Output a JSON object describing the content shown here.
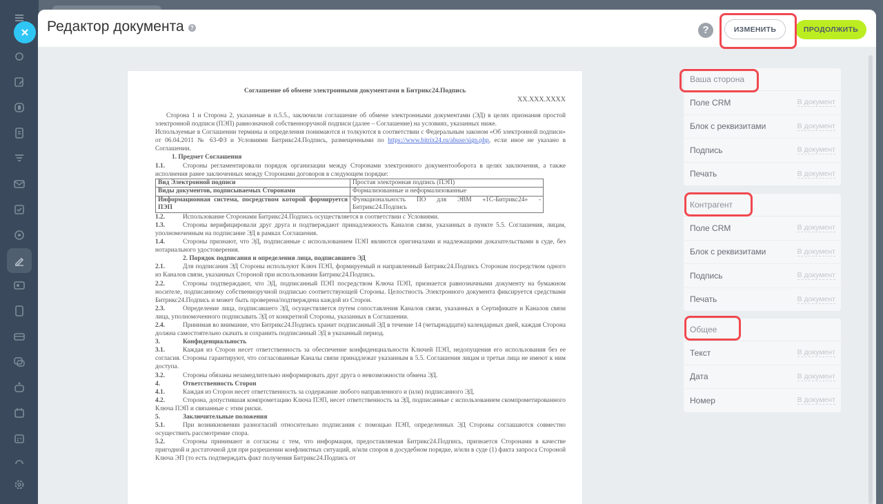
{
  "slider": {
    "title": "Редактор документа",
    "help_mark": "?",
    "help_button": "?",
    "change_label": "ИЗМЕНИТЬ",
    "continue_label": "ПРОДОЛЖИТЬ"
  },
  "app_sidebar": {
    "icons": [
      "menu-icon",
      "close-icon",
      "activity-icon",
      "tasks-edit-icon",
      "crm-icon",
      "document-icon",
      "filter-icon",
      "mail-icon",
      "checklist-icon",
      "target-icon",
      "sign-icon",
      "contact-card-icon",
      "file-icon",
      "storage-icon",
      "chat-icon",
      "bot-icon",
      "calendar-icon",
      "schedule-icon",
      "cloud-icon",
      "settings-icon"
    ]
  },
  "document": {
    "title": "Соглашение об обмене электронными документами в Битрикс24.Подпись",
    "number": "XX.XXX.XXXX",
    "intro1": "Сторона 1 и Сторона 2, указанные в п.5.5., заключили соглашение об обмене электронными документами (ЭД) в целях признания простой электронной подписи (ПЭП) равнозначной собственноручной подписи (далее – Соглашение) на условиях, указанных ниже.",
    "intro2": "Используемые в Соглашении термины и определения понимаются и толкуются в соответствии с Федеральным законом «Об электронной подписи» от 06.04.2011 № 63-ФЗ и Условиями Битрикс24.Подпись, размещенными по",
    "intro2_link": "https://www.bitrix24.ru/abuse/sign.php",
    "intro2_tail": ", если иное не указано в Соглашении.",
    "sec1": "1.    Предмет Соглашения",
    "p1_1_num": "1.1.",
    "p1_1": "Стороны регламентировали порядок организации между Сторонами электронного документооборота в целях заключения, а также исполнения ранее заключенных между Сторонами договоров в следующем порядке:",
    "table": [
      [
        "Вид Электронной подписи",
        "Простая электронная подпись (ПЭП)"
      ],
      [
        "Виды документов, подписываемых Сторонами",
        "Формализованные и неформализованные"
      ],
      [
        "Информационная система, посредством которой формируется ПЭП",
        "Функциональность ПО для ЭВМ «1С-Битрикс24» - Битрикс24.Подпись"
      ]
    ],
    "p1_2_num": "1.2.",
    "p1_2": "Использование Сторонами Битрикс24.Подпись осуществляется в соответствии с Условиями.",
    "p1_3_num": "1.3.",
    "p1_3": "Стороны верифицировали друг друга и подтверждают принадлежность Каналов связи, указанных в пункте 5.5. Соглашения, лицам, уполномоченным на подписание ЭД в рамках Соглашения.",
    "p1_4_num": "1.4.",
    "p1_4": "Стороны признают, что ЭД, подписанные с использованием ПЭП являются оригиналами и надлежащими доказательствами в суде, без нотариального удостоверения.",
    "sec2": "2.        Порядок подписания и определения лица, подписавшего ЭД",
    "p2_1_num": "2.1.",
    "p2_1": "Для подписания ЭД Стороны используют Ключ ПЭП, формируемый и направленный Битрикс24.Подпись Сторонам посредством одного из Каналов связи, указанных Стороной при использовании Битрикс24.Подпись.",
    "p2_2_num": "2.2.",
    "p2_2": "Стороны подтверждают, что ЭД, подписанный ПЭП посредством Ключа ПЭП, признается равнозначными документу на бумажном носителе, подписанному собственноручной подписью соответствующей Стороны. Целостность Электронного документа фиксируется средствами Битрикс24.Подпись и может быть проверена/подтверждена каждой из Сторон.",
    "p2_3_num": "2.3.",
    "p2_3": "Определение лица, подписавшего ЭД, осуществляется путем сопоставления Каналов связи, указанных в Сертификате и Каналов связи лица, уполномоченного подписывать ЭД от конкретной Стороны, указанных в Соглашении.",
    "p2_4_num": "2.4.",
    "p2_4": "Принимая во внимание, что Битрикс24.Подпись хранит подписанный ЭД в течение 14 (четырнадцати) календарных дней, каждая Сторона должна самостоятельно скачать и сохранить подписанный ЭД в указанный период.",
    "sec3_num": "3.",
    "sec3": "Конфиденциальность",
    "p3_1_num": "3.1.",
    "p3_1": "Каждая из Сторон несет ответственность за обеспечение конфиденциальности Ключей ПЭП, недопущения его использования без ее согласия. Стороны гарантируют, что согласованные Каналы связи принадлежат указанным в 5.5. Соглашения лицам и третьи лица не имеют к ним доступа.",
    "p3_2_num": "3.2.",
    "p3_2": "Стороны обязаны незамедлительно информировать друг друга о невозможности обмена ЭД.",
    "sec4_num": "4.",
    "sec4": "Ответственность Сторон",
    "p4_1_num": "4.1.",
    "p4_1": "Каждая из Сторон несет ответственность за содержание любого направленного и (или) подписанного ЭД.",
    "p4_2_num": "4.2.",
    "p4_2": "Сторона, допустившая компрометацию Ключа ПЭП, несет ответственность за ЭД, подписанные с использованием скомпрометированного Ключа ПЭП и связанные с этим риски.",
    "sec5_num": "5.",
    "sec5": "Заключительные положения",
    "p5_1_num": "5.1.",
    "p5_1": "При возникновении разногласий относительно подписания с помощью ПЭП, определенных ЭД Стороны соглашаются совместно осуществить рассмотрение спора.",
    "p5_2_num": "5.2.",
    "p5_2": "Стороны принимают и согласны с тем, что информация, предоставляемая Битрикс24.Подпись, признается Сторонами в качестве пригодной и достаточной для при разрешении конфликтных ситуаций, и/или споров в досудебном порядке, и/или в суде (1) факта запроса Стороной Ключа ЭП (то есть подтверждать факт получения Битрикс24.Подпись от"
  },
  "panels": {
    "your_side": {
      "title": "Ваша сторона",
      "rows": [
        {
          "label": "Поле CRM",
          "action": "В документ"
        },
        {
          "label": "Блок с реквизитами",
          "action": "В документ"
        },
        {
          "label": "Подпись",
          "action": "В документ"
        },
        {
          "label": "Печать",
          "action": "В документ"
        }
      ]
    },
    "counterparty": {
      "title": "Контрагент",
      "rows": [
        {
          "label": "Поле CRM",
          "action": "В документ"
        },
        {
          "label": "Блок с реквизитами",
          "action": "В документ"
        },
        {
          "label": "Подпись",
          "action": "В документ"
        },
        {
          "label": "Печать",
          "action": "В документ"
        }
      ]
    },
    "common": {
      "title": "Общее",
      "rows": [
        {
          "label": "Текст",
          "action": "В документ"
        },
        {
          "label": "Дата",
          "action": "В документ"
        },
        {
          "label": "Номер",
          "action": "В документ"
        }
      ]
    }
  },
  "colors": {
    "accent_blue": "#2fc6f6",
    "continue_green": "#bbed21",
    "highlight_red": "#f0484f",
    "overlay": "#5d6976"
  }
}
